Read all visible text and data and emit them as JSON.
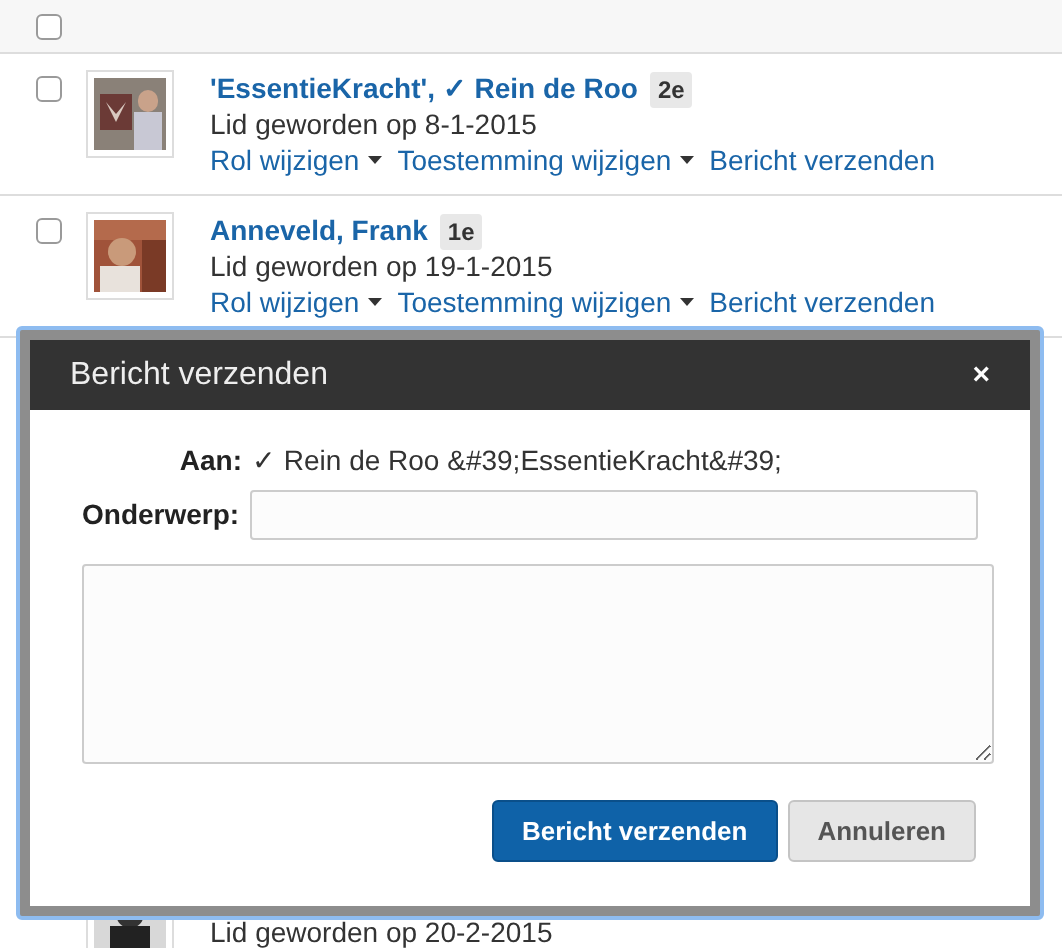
{
  "header": {
    "checked": false
  },
  "members": [
    {
      "name": "'EssentieKracht', ✓ Rein de Roo",
      "badge": "2e",
      "joined": "Lid geworden op 8-1-2015",
      "checked": false,
      "actions": [
        {
          "label": "Rol wijzigen",
          "dropdown": true
        },
        {
          "label": "Toestemming wijzigen",
          "dropdown": true
        },
        {
          "label": "Bericht verzenden",
          "dropdown": false
        }
      ]
    },
    {
      "name": "Anneveld, Frank",
      "badge": "1e",
      "joined": "Lid geworden op 19-1-2015",
      "checked": false,
      "actions": [
        {
          "label": "Rol wijzigen",
          "dropdown": true
        },
        {
          "label": "Toestemming wijzigen",
          "dropdown": true
        },
        {
          "label": "Bericht verzenden",
          "dropdown": false
        }
      ]
    },
    {
      "joined": "Lid geworden op 20-2-2015"
    }
  ],
  "dialog": {
    "title": "Bericht verzenden",
    "close": "×",
    "to_label": "Aan:",
    "to_value": "✓ Rein de Roo &#39;EssentieKracht&#39;",
    "subject_label": "Onderwerp:",
    "buttons": [
      {
        "label": "Bericht verzenden",
        "kind": "primary"
      },
      {
        "label": "Annuleren",
        "kind": "secondary"
      }
    ]
  }
}
